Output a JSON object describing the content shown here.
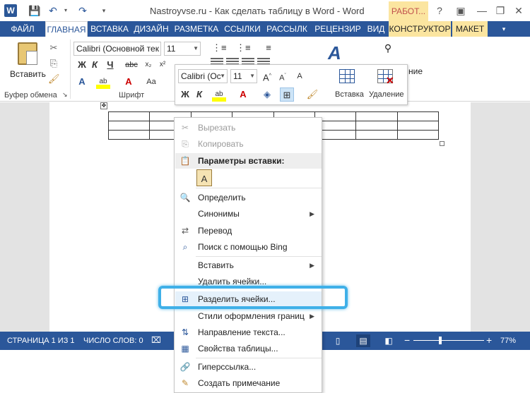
{
  "window": {
    "title": "Nastroyvse.ru - Как сделать таблицу в Word - Word",
    "context_tab_header": "РАБОТ...",
    "help": "?",
    "minimize": "—",
    "restore": "❐",
    "close": "✕"
  },
  "tabs": [
    "ФАЙЛ",
    "ГЛАВНАЯ",
    "ВСТАВКА",
    "ДИЗАЙН",
    "РАЗМЕТКА",
    "ССЫЛКИ",
    "РАССЫЛК",
    "РЕЦЕНЗИР",
    "ВИД",
    "КОНСТРУКТОР",
    "МАКЕТ"
  ],
  "active_tab": "ГЛАВНАЯ",
  "ribbon": {
    "paste_label": "Вставить",
    "clipboard_group": "Буфер обмена",
    "font_group": "Шрифт",
    "font_name": "Calibri (Основной тек",
    "font_size": "11",
    "editing_label": "ние"
  },
  "mini_toolbar": {
    "font_name": "Calibri (Ос",
    "font_size": "11",
    "insert_label": "Вставка",
    "delete_label": "Удаление"
  },
  "context_menu": {
    "items": [
      {
        "label": "Вырезать",
        "icon": "scissors-icon",
        "disabled": true
      },
      {
        "label": "Копировать",
        "icon": "copy-icon",
        "disabled": true
      },
      {
        "label": "Параметры вставки:",
        "icon": "clipboard-icon",
        "header": true
      },
      {
        "label": "Определить",
        "icon": "define-icon"
      },
      {
        "label": "Синонимы",
        "icon": "",
        "submenu": true
      },
      {
        "label": "Перевод",
        "icon": "translate-icon"
      },
      {
        "label": "Поиск с помощью Bing",
        "icon": "search-icon"
      },
      {
        "label": "Вставить",
        "icon": "",
        "submenu": true
      },
      {
        "label": "Удалить ячейки...",
        "icon": ""
      },
      {
        "label": "Разделить ячейки...",
        "icon": "split-cells-icon"
      },
      {
        "label": "Стили оформления границ",
        "icon": "",
        "submenu": true
      },
      {
        "label": "Направление текста...",
        "icon": "text-direction-icon"
      },
      {
        "label": "Свойства таблицы...",
        "icon": "table-properties-icon"
      },
      {
        "label": "Гиперссылка...",
        "icon": "link-icon"
      },
      {
        "label": "Создать примечание",
        "icon": "comment-icon"
      }
    ],
    "highlighted": "Разделить ячейки..."
  },
  "statusbar": {
    "page": "СТРАНИЦА 1 ИЗ 1",
    "words": "ЧИСЛО СЛОВ: 0",
    "zoom": "77%",
    "zoom_percent": 77,
    "zoom_minus": "−",
    "zoom_plus": "+"
  },
  "colors": {
    "accent": "#2b579a",
    "context_tab": "#fbe5a0",
    "highlight_outline": "#3fb0e8"
  }
}
